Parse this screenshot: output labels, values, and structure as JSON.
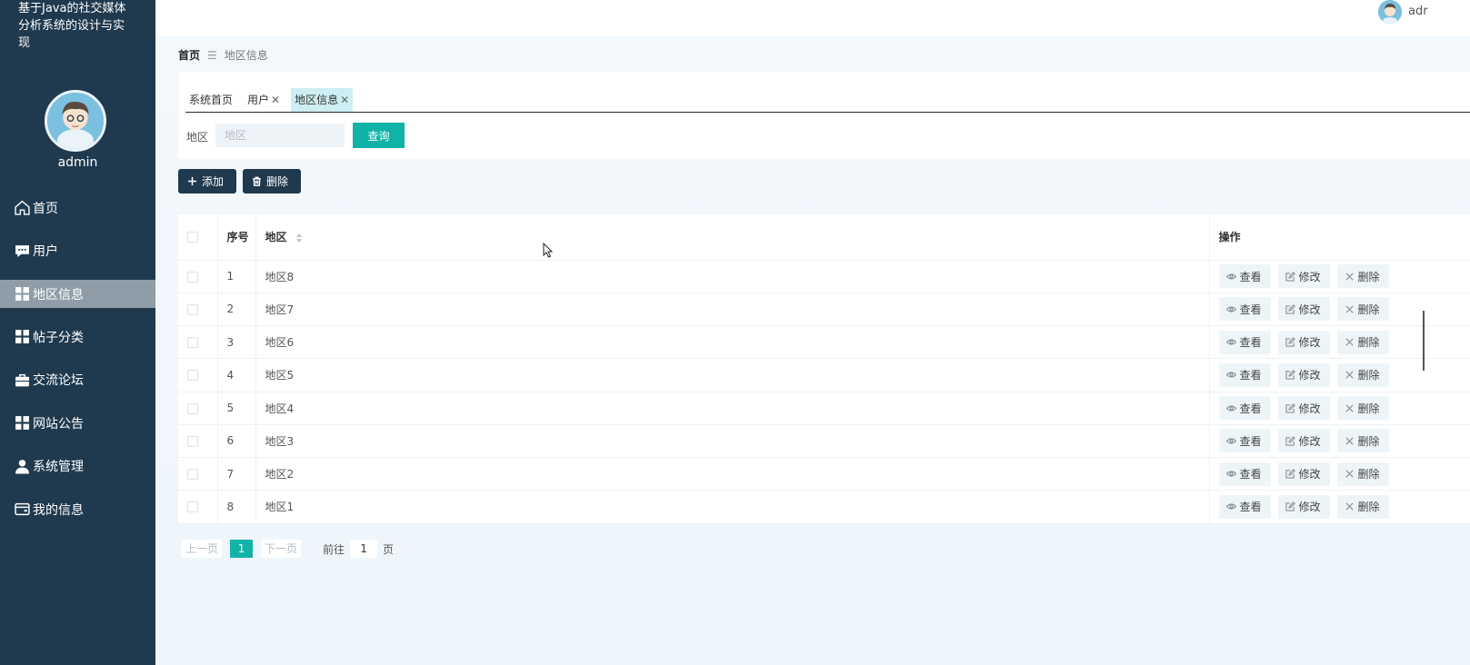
{
  "app": {
    "title": "基于Java的社交媒体分析系统的设计与实现",
    "title_lines": [
      "基于Java的社交媒体",
      "分析系统的设计与实",
      "现"
    ]
  },
  "user": {
    "name": "admin",
    "top_name": "adr"
  },
  "sidebar": {
    "items": [
      {
        "label": "首页",
        "icon": "home-icon",
        "active": false
      },
      {
        "label": "用户",
        "icon": "chat-icon",
        "active": false
      },
      {
        "label": "地区信息",
        "icon": "grid-icon",
        "active": true
      },
      {
        "label": "帖子分类",
        "icon": "grid-icon",
        "active": false
      },
      {
        "label": "交流论坛",
        "icon": "briefcase-icon",
        "active": false
      },
      {
        "label": "网站公告",
        "icon": "grid-icon",
        "active": false
      },
      {
        "label": "系统管理",
        "icon": "user-icon",
        "active": false
      },
      {
        "label": "我的信息",
        "icon": "card-icon",
        "active": false
      }
    ]
  },
  "breadcrumb": {
    "home": "首页",
    "separator": "☰",
    "current": "地区信息"
  },
  "tabs": [
    {
      "label": "系统首页",
      "closable": false,
      "active": false
    },
    {
      "label": "用户",
      "closable": true,
      "active": false
    },
    {
      "label": "地区信息",
      "closable": true,
      "active": true
    }
  ],
  "search": {
    "label": "地区",
    "placeholder": "地区",
    "value": "",
    "button": "查询"
  },
  "actions": {
    "add": "添加",
    "delete": "删除"
  },
  "table": {
    "headers": {
      "index": "序号",
      "area": "地区",
      "ops": "操作"
    },
    "rows": [
      {
        "index": "1",
        "area": "地区8"
      },
      {
        "index": "2",
        "area": "地区7"
      },
      {
        "index": "3",
        "area": "地区6"
      },
      {
        "index": "4",
        "area": "地区5"
      },
      {
        "index": "5",
        "area": "地区4"
      },
      {
        "index": "6",
        "area": "地区3"
      },
      {
        "index": "7",
        "area": "地区2"
      },
      {
        "index": "8",
        "area": "地区1"
      }
    ],
    "row_actions": {
      "view": "查看",
      "edit": "修改",
      "delete": "删除"
    }
  },
  "pagination": {
    "prev": "上一页",
    "current": "1",
    "next": "下一页",
    "goto_label": "前往",
    "goto_value": "1",
    "unit": "页"
  },
  "colors": {
    "sidebar_bg": "#1f3a4f",
    "sidebar_active": "#8e9da7",
    "accent": "#11b3a9",
    "dark_button": "#1f3a4f",
    "active_tab": "#cdeef2"
  }
}
